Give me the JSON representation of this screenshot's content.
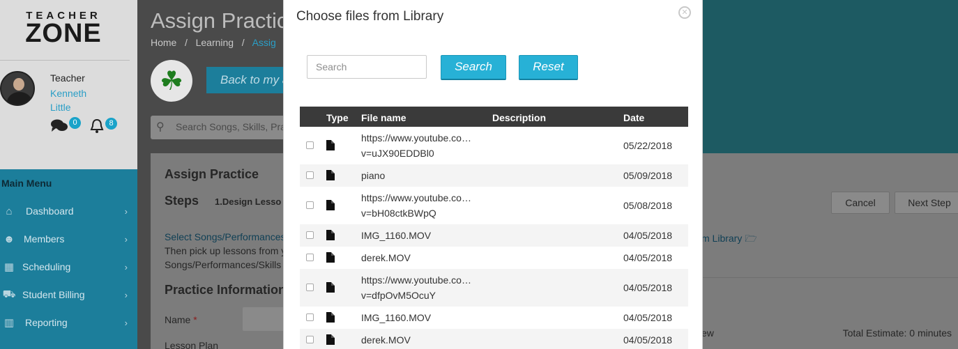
{
  "sidebar": {
    "logo_top": "TEACHER",
    "logo_bottom": "ZONE",
    "user_role": "Teacher",
    "user_name": "Kenneth Little",
    "messages_count": "0",
    "notifications_count": "8",
    "menu_title": "Main Menu",
    "menu": [
      {
        "label": "Dashboard",
        "icon": "home-icon"
      },
      {
        "label": "Members",
        "icon": "users-icon"
      },
      {
        "label": "Scheduling",
        "icon": "calendar-icon"
      },
      {
        "label": "Student Billing",
        "icon": "cart-icon"
      },
      {
        "label": "Reporting",
        "icon": "bar-chart-icon"
      }
    ]
  },
  "main": {
    "title": "Assign Practic",
    "breadcrumbs": [
      "Home",
      "Learning",
      "Assig"
    ],
    "back_button": "Back to my a",
    "search_placeholder": "Search Songs, Skills, Pra",
    "panel_title": "Assign Practice",
    "steps_label": "Steps",
    "step1": "1.Design Lesso",
    "line1": "Select Songs/Performances",
    "line2": "Then pick up lessons from y",
    "line3": "Songs/Performances/Skills",
    "library_link": "m Library",
    "practice_info": "Practice Information",
    "name_label": "Name",
    "required_mark": "*",
    "lesson_plan": "Lesson Plan",
    "cancel": "Cancel",
    "next_step": "Next Step",
    "ew_text": "ew",
    "total_estimate": "Total Estimate: 0 minutes"
  },
  "modal": {
    "title": "Choose files from Library",
    "search_placeholder": "Search",
    "search_value": "",
    "search_button": "Search",
    "reset_button": "Reset",
    "columns": {
      "type": "Type",
      "file_name": "File name",
      "description": "Description",
      "date": "Date"
    },
    "rows": [
      {
        "name": "https://www.youtube.co… v=uJX90EDDBl0",
        "date": "05/22/2018",
        "tall": true
      },
      {
        "name": "piano",
        "date": "05/09/2018",
        "tall": false
      },
      {
        "name": "https://www.youtube.co… v=bH08ctkBWpQ",
        "date": "05/08/2018",
        "tall": true
      },
      {
        "name": "IMG_1160.MOV",
        "date": "04/05/2018",
        "tall": false
      },
      {
        "name": "derek.MOV",
        "date": "04/05/2018",
        "tall": false
      },
      {
        "name": "https://www.youtube.co… v=dfpOvM5OcuY",
        "date": "04/05/2018",
        "tall": true
      },
      {
        "name": "IMG_1160.MOV",
        "date": "04/05/2018",
        "tall": false
      },
      {
        "name": "derek.MOV",
        "date": "04/05/2018",
        "tall": false
      }
    ]
  }
}
